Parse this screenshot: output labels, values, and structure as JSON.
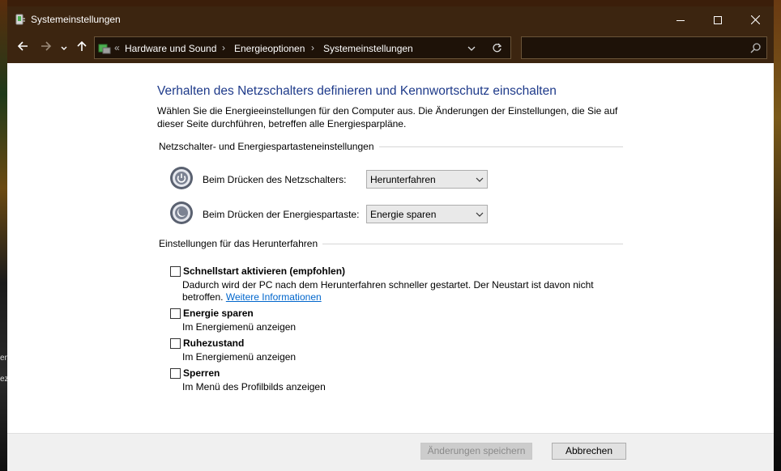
{
  "window": {
    "title": "Systemeinstellungen"
  },
  "nav": {
    "breadcrumbs": [
      "Hardware und Sound",
      "Energieoptionen",
      "Systemeinstellungen"
    ],
    "search_placeholder": "",
    "icons": {
      "back": "arrow-left-icon",
      "forward": "arrow-right-icon",
      "recent": "chevron-down-icon",
      "up": "arrow-up-icon"
    }
  },
  "main": {
    "title": "Verhalten des Netzschalters definieren und Kennwortschutz einschalten",
    "intro": "Wählen Sie die Energieeinstellungen für den Computer aus. Die Änderungen der Einstellungen, die Sie auf dieser Seite durchführen, betreffen alle Energiesparpläne.",
    "section1": {
      "heading": "Netzschalter- und Energiespartasteneinstellungen",
      "power_button": {
        "label": "Beim Drücken des Netzschalters:",
        "value": "Herunterfahren"
      },
      "sleep_button": {
        "label": "Beim Drücken der Energiespartaste:",
        "value": "Energie sparen"
      }
    },
    "section2": {
      "heading": "Einstellungen für das Herunterfahren",
      "fast_startup": {
        "title": "Schnellstart aktivieren (empfohlen)",
        "desc": "Dadurch wird der PC nach dem Herunterfahren schneller gestartet. Der Neustart ist davon nicht betroffen.",
        "link": "Weitere Informationen",
        "checked": false
      },
      "sleep": {
        "title": "Energie sparen",
        "desc": "Im Energiemenü anzeigen",
        "checked": false
      },
      "hibernate": {
        "title": "Ruhezustand",
        "desc": "Im Energiemenü anzeigen",
        "checked": false
      },
      "lock": {
        "title": "Sperren",
        "desc": "Im Menü des Profilbilds anzeigen",
        "checked": false
      }
    }
  },
  "footer": {
    "save_label": "Änderungen speichern",
    "cancel_label": "Abbrechen"
  },
  "desktop": {
    "edge_text_1": "en",
    "edge_text_2": "ez"
  },
  "colors": {
    "titlebar": "#3c2510",
    "title_blue": "#1e3a8a",
    "link": "#0066cc"
  }
}
